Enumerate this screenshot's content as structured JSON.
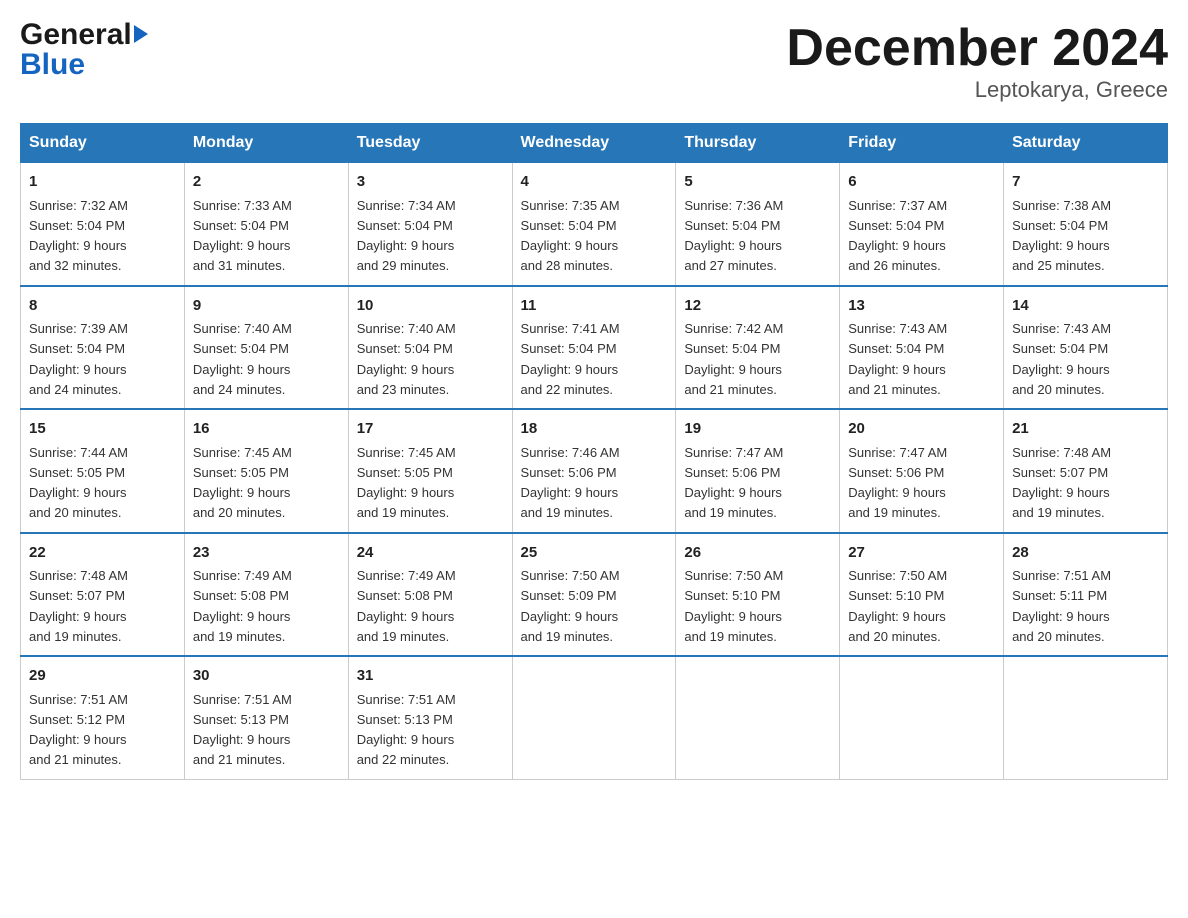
{
  "logo": {
    "line1": "General",
    "line2": "Blue"
  },
  "title": "December 2024",
  "subtitle": "Leptokarya, Greece",
  "days_of_week": [
    "Sunday",
    "Monday",
    "Tuesday",
    "Wednesday",
    "Thursday",
    "Friday",
    "Saturday"
  ],
  "weeks": [
    [
      {
        "day": "1",
        "sunrise": "7:32 AM",
        "sunset": "5:04 PM",
        "daylight": "9 hours and 32 minutes."
      },
      {
        "day": "2",
        "sunrise": "7:33 AM",
        "sunset": "5:04 PM",
        "daylight": "9 hours and 31 minutes."
      },
      {
        "day": "3",
        "sunrise": "7:34 AM",
        "sunset": "5:04 PM",
        "daylight": "9 hours and 29 minutes."
      },
      {
        "day": "4",
        "sunrise": "7:35 AM",
        "sunset": "5:04 PM",
        "daylight": "9 hours and 28 minutes."
      },
      {
        "day": "5",
        "sunrise": "7:36 AM",
        "sunset": "5:04 PM",
        "daylight": "9 hours and 27 minutes."
      },
      {
        "day": "6",
        "sunrise": "7:37 AM",
        "sunset": "5:04 PM",
        "daylight": "9 hours and 26 minutes."
      },
      {
        "day": "7",
        "sunrise": "7:38 AM",
        "sunset": "5:04 PM",
        "daylight": "9 hours and 25 minutes."
      }
    ],
    [
      {
        "day": "8",
        "sunrise": "7:39 AM",
        "sunset": "5:04 PM",
        "daylight": "9 hours and 24 minutes."
      },
      {
        "day": "9",
        "sunrise": "7:40 AM",
        "sunset": "5:04 PM",
        "daylight": "9 hours and 24 minutes."
      },
      {
        "day": "10",
        "sunrise": "7:40 AM",
        "sunset": "5:04 PM",
        "daylight": "9 hours and 23 minutes."
      },
      {
        "day": "11",
        "sunrise": "7:41 AM",
        "sunset": "5:04 PM",
        "daylight": "9 hours and 22 minutes."
      },
      {
        "day": "12",
        "sunrise": "7:42 AM",
        "sunset": "5:04 PM",
        "daylight": "9 hours and 21 minutes."
      },
      {
        "day": "13",
        "sunrise": "7:43 AM",
        "sunset": "5:04 PM",
        "daylight": "9 hours and 21 minutes."
      },
      {
        "day": "14",
        "sunrise": "7:43 AM",
        "sunset": "5:04 PM",
        "daylight": "9 hours and 20 minutes."
      }
    ],
    [
      {
        "day": "15",
        "sunrise": "7:44 AM",
        "sunset": "5:05 PM",
        "daylight": "9 hours and 20 minutes."
      },
      {
        "day": "16",
        "sunrise": "7:45 AM",
        "sunset": "5:05 PM",
        "daylight": "9 hours and 20 minutes."
      },
      {
        "day": "17",
        "sunrise": "7:45 AM",
        "sunset": "5:05 PM",
        "daylight": "9 hours and 19 minutes."
      },
      {
        "day": "18",
        "sunrise": "7:46 AM",
        "sunset": "5:06 PM",
        "daylight": "9 hours and 19 minutes."
      },
      {
        "day": "19",
        "sunrise": "7:47 AM",
        "sunset": "5:06 PM",
        "daylight": "9 hours and 19 minutes."
      },
      {
        "day": "20",
        "sunrise": "7:47 AM",
        "sunset": "5:06 PM",
        "daylight": "9 hours and 19 minutes."
      },
      {
        "day": "21",
        "sunrise": "7:48 AM",
        "sunset": "5:07 PM",
        "daylight": "9 hours and 19 minutes."
      }
    ],
    [
      {
        "day": "22",
        "sunrise": "7:48 AM",
        "sunset": "5:07 PM",
        "daylight": "9 hours and 19 minutes."
      },
      {
        "day": "23",
        "sunrise": "7:49 AM",
        "sunset": "5:08 PM",
        "daylight": "9 hours and 19 minutes."
      },
      {
        "day": "24",
        "sunrise": "7:49 AM",
        "sunset": "5:08 PM",
        "daylight": "9 hours and 19 minutes."
      },
      {
        "day": "25",
        "sunrise": "7:50 AM",
        "sunset": "5:09 PM",
        "daylight": "9 hours and 19 minutes."
      },
      {
        "day": "26",
        "sunrise": "7:50 AM",
        "sunset": "5:10 PM",
        "daylight": "9 hours and 19 minutes."
      },
      {
        "day": "27",
        "sunrise": "7:50 AM",
        "sunset": "5:10 PM",
        "daylight": "9 hours and 20 minutes."
      },
      {
        "day": "28",
        "sunrise": "7:51 AM",
        "sunset": "5:11 PM",
        "daylight": "9 hours and 20 minutes."
      }
    ],
    [
      {
        "day": "29",
        "sunrise": "7:51 AM",
        "sunset": "5:12 PM",
        "daylight": "9 hours and 21 minutes."
      },
      {
        "day": "30",
        "sunrise": "7:51 AM",
        "sunset": "5:13 PM",
        "daylight": "9 hours and 21 minutes."
      },
      {
        "day": "31",
        "sunrise": "7:51 AM",
        "sunset": "5:13 PM",
        "daylight": "9 hours and 22 minutes."
      },
      null,
      null,
      null,
      null
    ]
  ],
  "labels": {
    "sunrise": "Sunrise:",
    "sunset": "Sunset:",
    "daylight": "Daylight:"
  }
}
